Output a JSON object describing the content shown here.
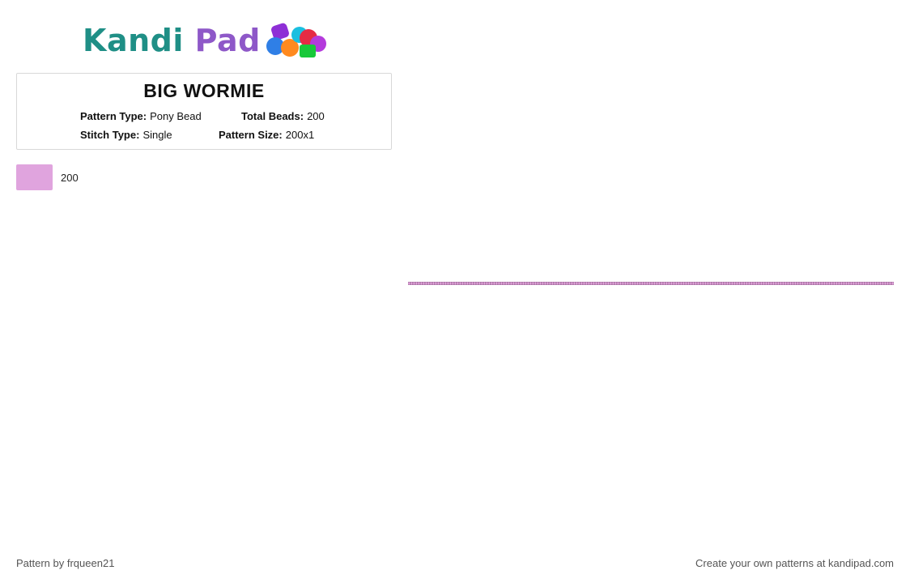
{
  "logo": {
    "part1": "Kandi",
    "part2": "Pad",
    "teal": "#1f8f86",
    "purple": "#8e58c8"
  },
  "pattern": {
    "title": "BIG WORMIE",
    "pattern_type_label": "Pattern Type:",
    "pattern_type_value": "Pony Bead",
    "total_beads_label": "Total Beads:",
    "total_beads_value": "200",
    "stitch_type_label": "Stitch Type:",
    "stitch_type_value": "Single",
    "pattern_size_label": "Pattern Size:",
    "pattern_size_value": "200x1"
  },
  "legend": [
    {
      "color": "#e0a4de",
      "count": "200"
    }
  ],
  "grid": {
    "columns": 200,
    "rows": 1,
    "bead_color": "#e6a7df",
    "border_color": "#7d4f7a"
  },
  "footer": {
    "left": "Pattern by frqueen21",
    "right": "Create your own patterns at kandipad.com"
  }
}
